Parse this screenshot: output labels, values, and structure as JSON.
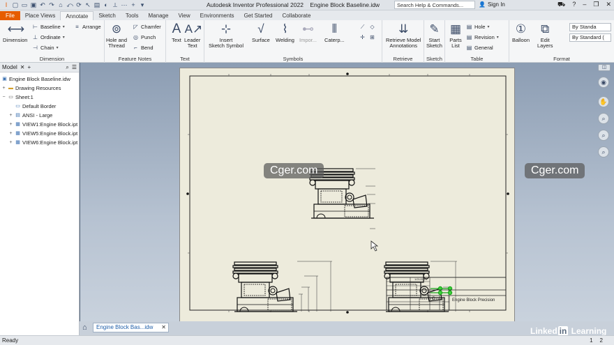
{
  "window": {
    "app_title": "Autodesk Inventor Professional 2022",
    "doc_title": "Engine Block Baseline.idw",
    "search_placeholder": "Search Help & Commands...",
    "sign_in": "Sign In"
  },
  "tabs": [
    "File",
    "Place Views",
    "Annotate",
    "Sketch",
    "Tools",
    "Manage",
    "View",
    "Environments",
    "Get Started",
    "Collaborate"
  ],
  "active_tab": "Annotate",
  "ribbon": {
    "dimension": {
      "big": "Dimension",
      "baseline": "Baseline",
      "ordinate": "Ordinate",
      "chain": "Chain",
      "arrange": "Arrange",
      "label": "Dimension"
    },
    "feature_notes": {
      "hole_thread_1": "Hole and",
      "hole_thread_2": "Thread",
      "chamfer": "Chamfer",
      "punch": "Punch",
      "bend": "Bend",
      "label": "Feature Notes"
    },
    "text": {
      "text": "Text",
      "leader_1": "Leader",
      "leader_2": "Text",
      "label": "Text"
    },
    "symbols": {
      "insert_1": "Insert",
      "insert_2": "Sketch Symbol",
      "surface": "Surface",
      "welding": "Welding",
      "import": "Impor...",
      "caterpillar": "Caterp...",
      "label": "Symbols"
    },
    "retrieve": {
      "btn_1": "Retrieve Model",
      "btn_2": "Annotations",
      "label": "Retrieve"
    },
    "sketch": {
      "btn_1": "Start",
      "btn_2": "Sketch",
      "label": "Sketch"
    },
    "table": {
      "parts_1": "Parts",
      "parts_2": "List",
      "hole": "Hole",
      "revision": "Revision",
      "general": "General",
      "label": "Table"
    },
    "format": {
      "balloon": "Balloon",
      "edit_1": "Edit",
      "edit_2": "Layers",
      "style1": "By Standa",
      "style2": "By Standard (",
      "label": "Format"
    }
  },
  "browser": {
    "title": "Model",
    "items": [
      "Engine Block Baseline.idw",
      "Drawing Resources",
      "Sheet:1",
      "Default Border",
      "ANSI - Large",
      "VIEW1:Engine Block.ipt",
      "VIEW5:Engine Block.ipt",
      "VIEW6:Engine Block.ipt"
    ]
  },
  "title_block": {
    "part_name": "Engine Block Precision",
    "date": "1/21/2014",
    "size": "C"
  },
  "watermarks": [
    "Cger.com",
    "Cger.com"
  ],
  "doc_tab": "Engine Block Bas...idw",
  "status": "Ready",
  "pages": [
    "1",
    "2"
  ],
  "brand": {
    "pre": "Linked",
    "in": "in",
    "post": " Learning"
  }
}
